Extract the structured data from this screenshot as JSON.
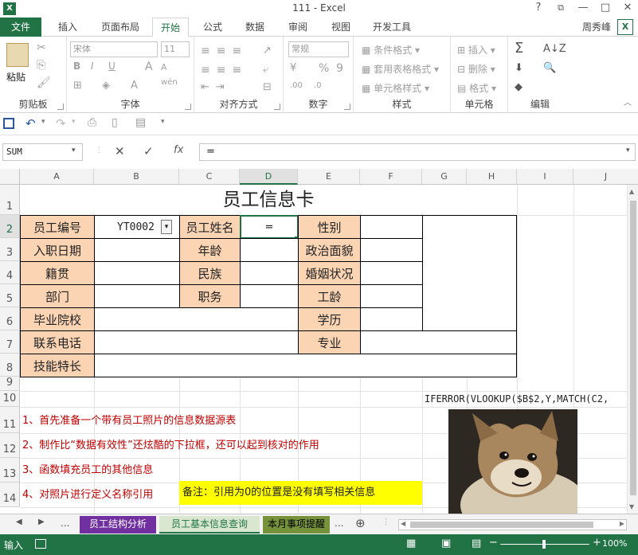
{
  "window": {
    "title": "111  -  Excel",
    "help": "?",
    "restore": "⧉",
    "minimize": "—",
    "maximize": "□",
    "close": "✕"
  },
  "tabs": {
    "file": "文件",
    "insert": "插入",
    "layout": "页面布局",
    "home": "开始",
    "formulas": "公式",
    "data": "数据",
    "review": "审阅",
    "view": "视图",
    "developer": "开发工具"
  },
  "user": "周秀峰",
  "ribbon": {
    "clipboard": {
      "label": "剪贴板",
      "paste": "粘贴"
    },
    "font": {
      "label": "字体",
      "font_name": "宋体",
      "font_size": "11",
      "bold": "B",
      "italic": "I",
      "underline": "U",
      "grow": "A",
      "shrink": "A",
      "wen": "wén"
    },
    "alignment": {
      "label": "对齐方式"
    },
    "number": {
      "label": "数字",
      "format": "常规",
      "percent": "%",
      "comma": "9"
    },
    "styles": {
      "label": "样式",
      "conditional": "条件格式",
      "table": "套用表格格式",
      "cell": "单元格样式"
    },
    "cells": {
      "label": "单元格",
      "insert": "插入",
      "delete": "删除",
      "format": "格式"
    },
    "editing": {
      "label": "编辑",
      "sum": "Σ"
    }
  },
  "formula_bar": {
    "name_box": "SUM",
    "cancel": "✕",
    "enter": "✓",
    "fx": "fx",
    "content": "="
  },
  "columns": [
    "A",
    "B",
    "C",
    "D",
    "E",
    "F",
    "G",
    "H",
    "I",
    "J"
  ],
  "rows": [
    "1",
    "2",
    "3",
    "4",
    "5",
    "6",
    "7",
    "8",
    "9",
    "10",
    "11",
    "12",
    "13",
    "14"
  ],
  "card": {
    "title": "员工信息卡",
    "r2": {
      "a": "员工编号",
      "b": "YT0002",
      "c": "员工姓名",
      "d": "=",
      "e": "性别"
    },
    "r3": {
      "a": "入职日期",
      "c": "年龄",
      "e": "政治面貌"
    },
    "r4": {
      "a": "籍贯",
      "c": "民族",
      "e": "婚姻状况"
    },
    "r5": {
      "a": "部门",
      "c": "职务",
      "e": "工龄"
    },
    "r6": {
      "a": "毕业院校",
      "e": "学历"
    },
    "r7": {
      "a": "联系电话",
      "e": "专业"
    },
    "r8": {
      "a": "技能特长"
    }
  },
  "formula_text": "IFERROR(VLOOKUP($B$2,Y,MATCH(C2,",
  "notes": [
    "1、首先准备一个带有员工照片的信息数据源表",
    "2、制作比“数据有效性”还炫酷的下拉框，还可以起到核对的作用",
    "3、函数填充员工的其他信息",
    "4、对照片进行定义名称引用"
  ],
  "remark": "备注：引用为0的位置是没有填写相关信息",
  "sheets": {
    "ellipsis_left": "...",
    "s1": "员工结构分析",
    "s2": "员工基本信息查询",
    "s3": "本月事项提醒",
    "ellipsis_right": "...",
    "add": "⊕"
  },
  "status": {
    "mode": "输入",
    "zoom": "100%"
  },
  "colors": {
    "accent": "#217346",
    "label_fill": "#fbd4b4",
    "remark_fill": "#ffff00",
    "note_text": "#c00000",
    "tab1": "#7030a0",
    "tab2": "#d9e7d0",
    "tab3": "#76933c"
  }
}
